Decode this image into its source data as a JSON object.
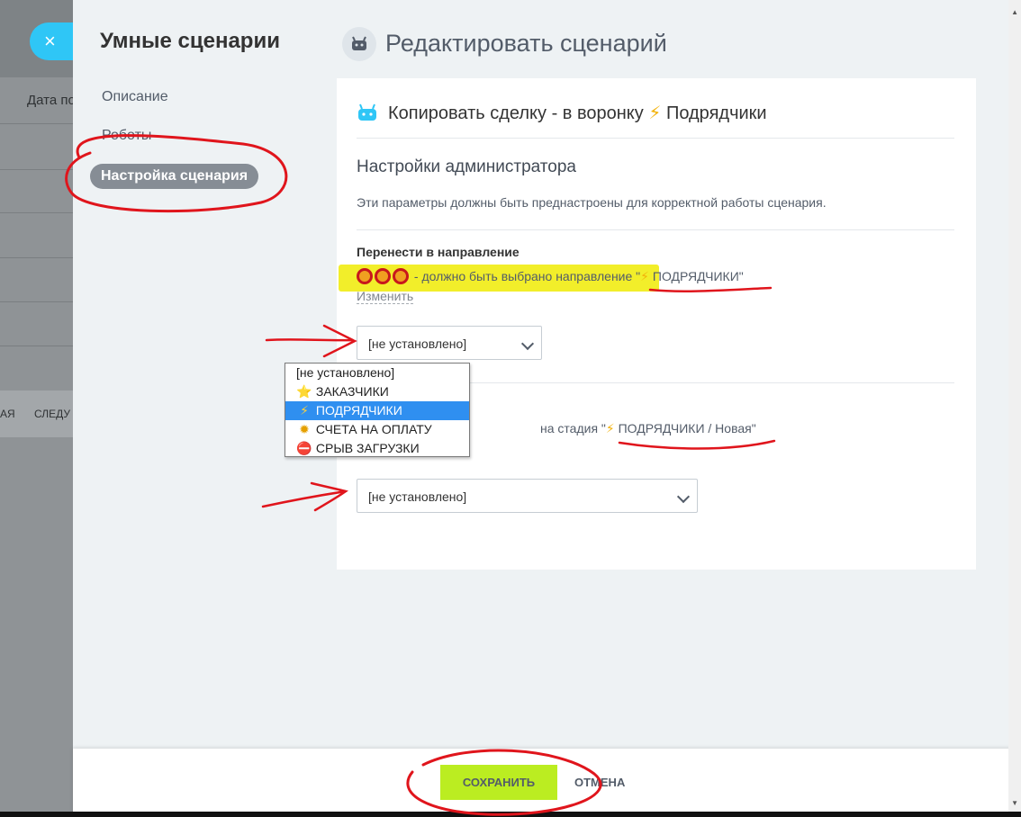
{
  "background": {
    "header_text": "Дата по",
    "footer_left": "АЯ",
    "footer_right": "СЛЕДУ",
    "close_icon": "×"
  },
  "nav": {
    "title": "Умные сценарии",
    "items": [
      "Описание",
      "Роботы",
      "Настройка сценария"
    ]
  },
  "header": {
    "title": "Редактировать сценарий"
  },
  "card": {
    "title_prefix": "Копировать сделку - в воронку",
    "title_icon": "⚡",
    "title_suffix": "Подрядчики",
    "section_title": "Настройки администратора",
    "section_hint": "Эти параметры должны быть преднастроены для корректной работы сценария.",
    "field1": {
      "label": "Перенести в направление",
      "note_prefix": " - должно быть выбрано направление \"",
      "note_icon": "⚡",
      "note_value": " ПОДРЯДЧИКИ",
      "note_suffix": "\"",
      "change": "Изменить",
      "selected": "[не установлено]"
    },
    "field2": {
      "note_prefix": "на стадия \"",
      "note_icon": "⚡",
      "note_value": " ПОДРЯДЧИКИ / Новая",
      "note_suffix": "\"",
      "selected": "[не установлено]"
    }
  },
  "dropdown": {
    "options": [
      {
        "icon": "",
        "label": "[не установлено]"
      },
      {
        "icon": "⭐",
        "label": "ЗАКАЗЧИКИ"
      },
      {
        "icon": "⚡",
        "label": "ПОДРЯДЧИКИ"
      },
      {
        "icon": "✹",
        "label": "СЧЕТА НА ОПЛАТУ"
      },
      {
        "icon": "⛔",
        "label": "СРЫВ ЗАГРУЗКИ"
      }
    ],
    "selected_index": 2
  },
  "footer": {
    "save": "СОХРАНИТЬ",
    "cancel": "ОТМЕНА"
  },
  "colors": {
    "accent": "#2fc6f6",
    "save": "#bbed21",
    "highlight": "#f2ee2a",
    "annotation": "#e0151c"
  }
}
